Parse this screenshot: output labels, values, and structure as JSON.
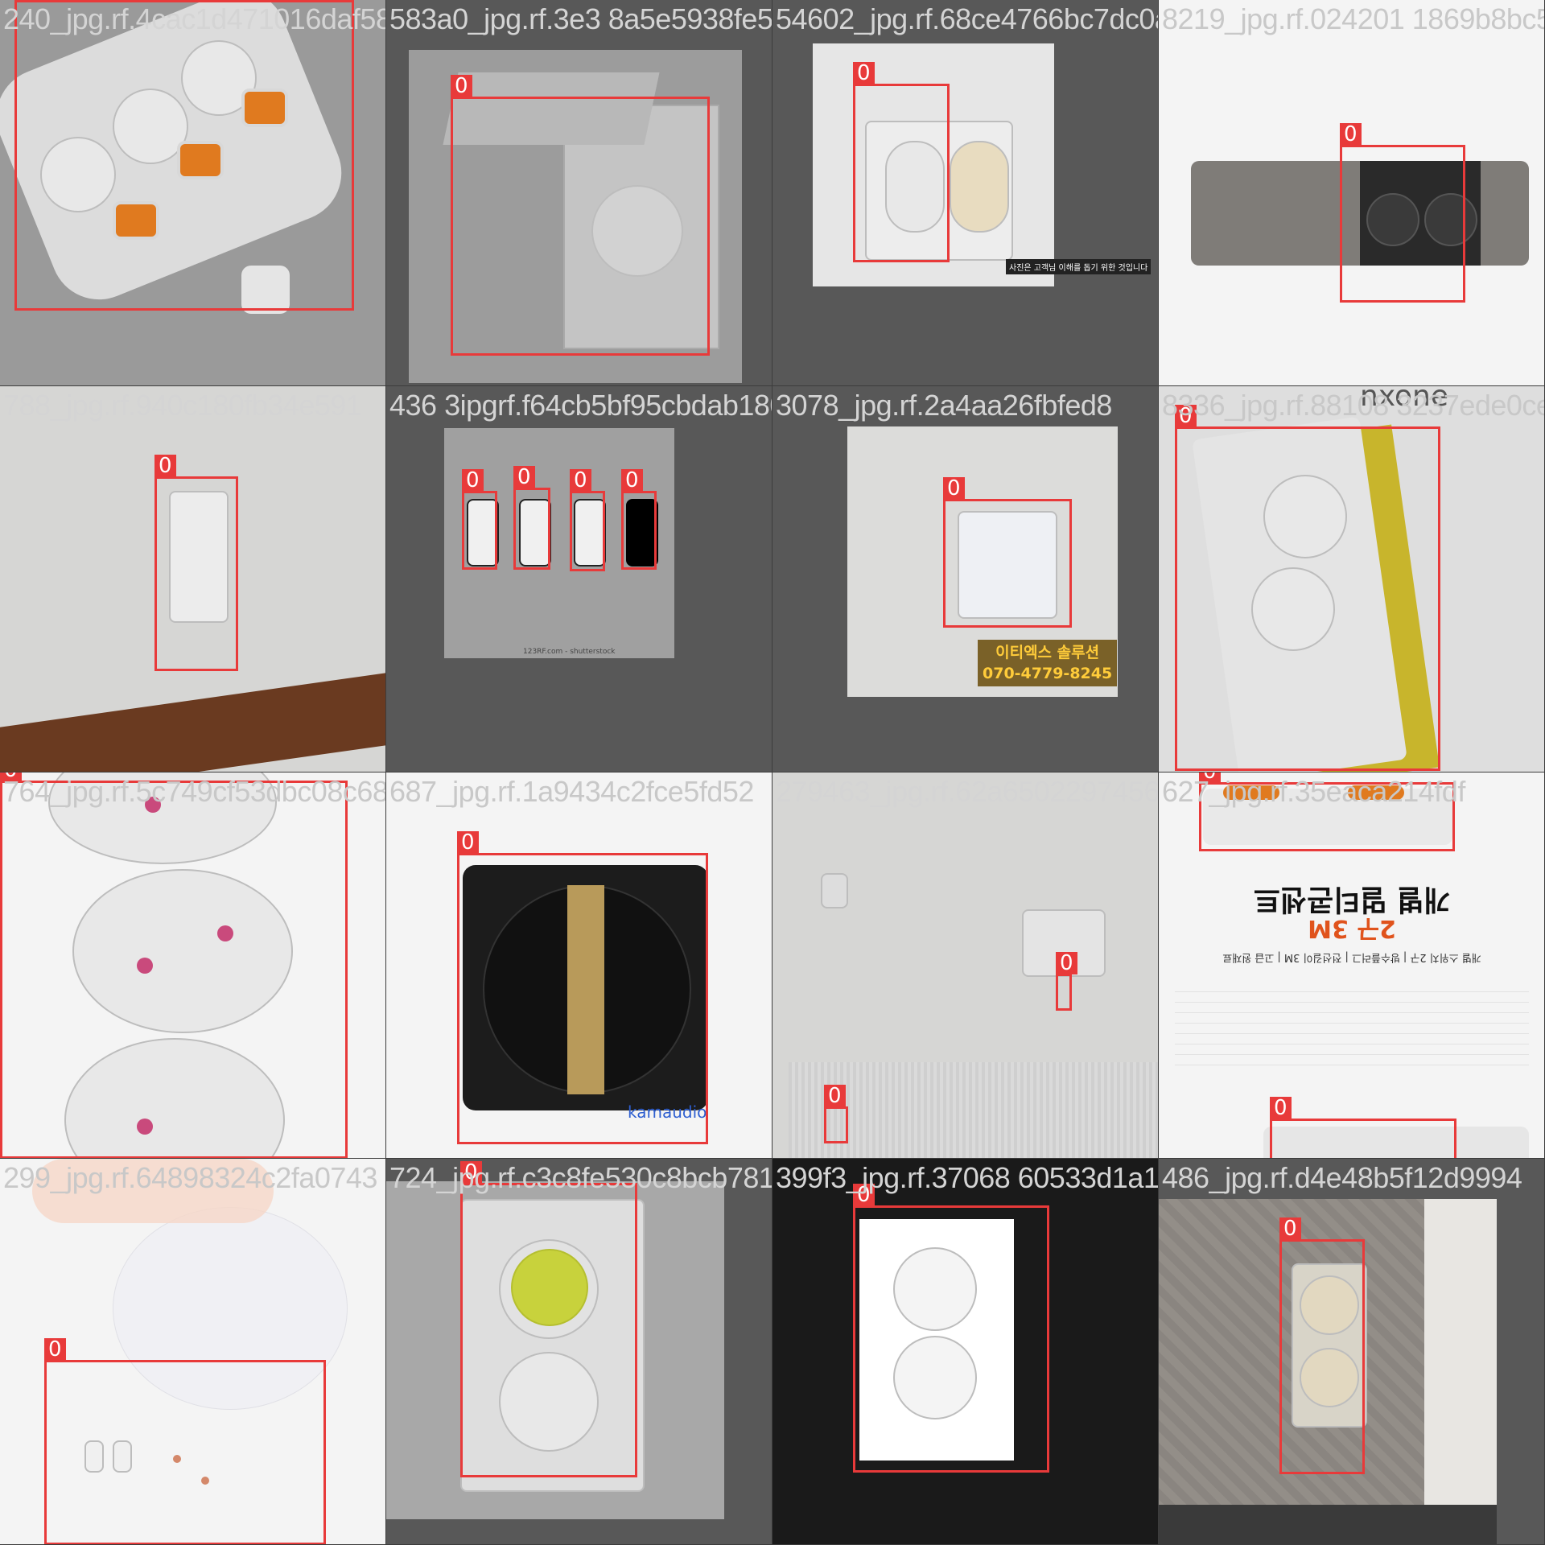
{
  "grid": {
    "rows": 4,
    "cols": 4,
    "box_color": "#e83a3a",
    "class_label": "0"
  },
  "tiles": [
    {
      "filename": "240_jpg.rf.4cac1d471016daf5830 3b8fe5938fe57ba03a6",
      "background": "gray",
      "label": "0"
    },
    {
      "filename": "583a0_jpg.rf.3e3 8a5e5938fe57ba03a65",
      "background": "dark",
      "label": "0"
    },
    {
      "filename": "54602_jpg.rf.68ce4766bc7dc0a5829",
      "background": "dark",
      "label": "0"
    },
    {
      "filename": "8219_jpg.rf.024201 1869b8bc5",
      "background": "white",
      "label": "0"
    },
    {
      "filename": "788_jpg.rf.940c180fb34e591",
      "background": "wall",
      "label": "0"
    },
    {
      "filename": "436 3ipgrf.f64cb5bf95cbdab18078",
      "background": "dark",
      "label": "0"
    },
    {
      "filename": "3078_jpg.rf.2a4aa26fbfed8",
      "background": "dark",
      "label": "0"
    },
    {
      "filename": "8336_jpg.rf.88108 3237ede0ce",
      "background": "gray",
      "label": "0"
    },
    {
      "filename": "764_jpg.rf.5c749cf53dbc08c687",
      "background": "white",
      "label": "0"
    },
    {
      "filename": "687_jpg.rf.1a9434c2fce5fd52",
      "background": "white",
      "label": "0"
    },
    {
      "filename": "279463_jpg.rf.62a6502297456ad6",
      "background": "wall",
      "label": "0"
    },
    {
      "filename": "627_jpg.rf.35eaca214fdf",
      "background": "white",
      "label": "0"
    },
    {
      "filename": "299_jpg.rf.64898324c2fa0743",
      "background": "white",
      "label": "0"
    },
    {
      "filename": "724_jpg.rf.c3c8fe530c8bcb7817",
      "background": "dark",
      "label": "0"
    },
    {
      "filename": "399f3_jpg.rf.37068 60533d1a124",
      "background": "black",
      "label": "0"
    },
    {
      "filename": "486_jpg.rf.d4e48b5f12d9994",
      "background": "dark",
      "label": "0"
    }
  ],
  "text_in_images": {
    "tile_3_tag": "사진은 고객님 이해를 돕기 위한 것입니다",
    "tile_7_sign_line1": "이티엑스 솔루션",
    "tile_7_sign_line2": "070-4779-8245",
    "tile_8_brand": "nxone",
    "tile_10_brand": "kamaudio",
    "tile_12_title": "개별 멀티콘센트",
    "tile_12_subtitle": "2구 3M",
    "tile_12_specline": "개별 스위치 2구 | 방수플러그 | 전선길이 3M | 고급 원재료",
    "tile_6_caption": "123RF.com - shutterstock"
  },
  "colors": {
    "box": "#e83a3a",
    "switch_orange": "#e07a1f",
    "strip_yellow": "#c8b52c",
    "sign_text": "#ffcc3a"
  }
}
